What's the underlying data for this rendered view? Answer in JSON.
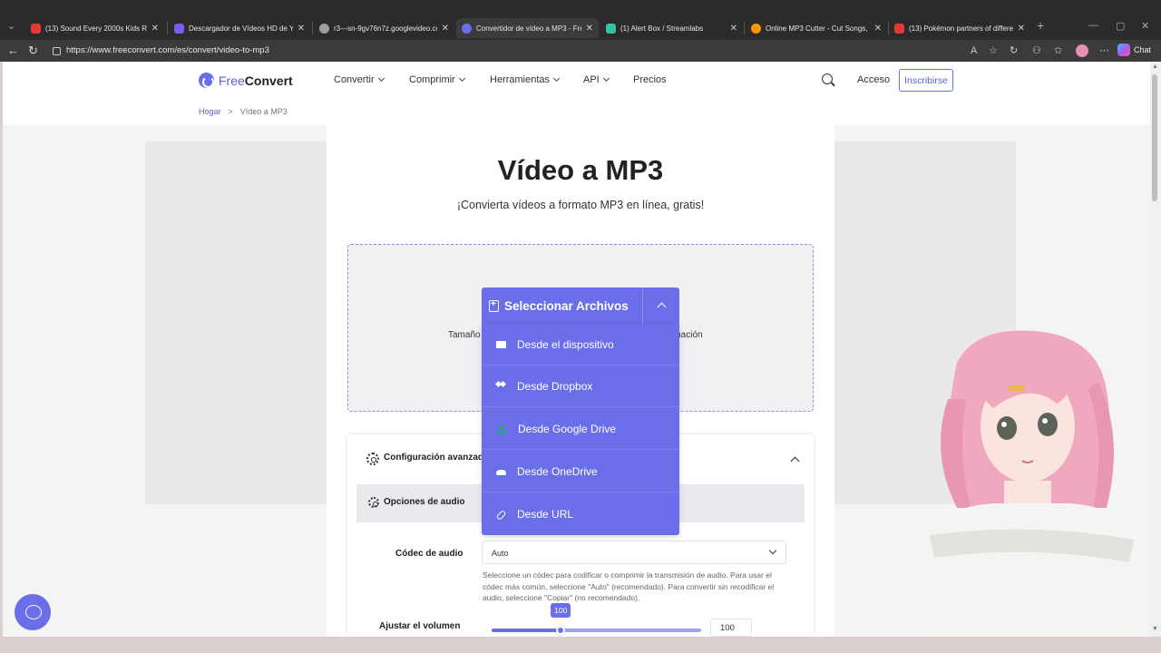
{
  "browser": {
    "tabs": [
      {
        "title": "(13) Sound Every 2000s Kids Reme",
        "active": false,
        "color": "#e53935"
      },
      {
        "title": "Descargador de Vídeos HD de You",
        "active": false,
        "color": "#7b5cf2"
      },
      {
        "title": "r3---sn-9gv76n7z.googlevideo.com",
        "active": false,
        "color": "#9e9e9e"
      },
      {
        "title": "Convertidor de vídeo a MP3 - Fre",
        "active": true,
        "color": "#6a6ee8"
      },
      {
        "title": "(1) Alert Box / Streamlabs",
        "active": false,
        "color": "#31c3a2"
      },
      {
        "title": "Online MP3 Cutter - Cut Songs, M",
        "active": false,
        "color": "#ff9800"
      },
      {
        "title": "(13) Pokémon partners of differen",
        "active": false,
        "color": "#e53935"
      }
    ],
    "url": "https://www.freeconvert.com/es/convert/video-to-mp3",
    "chat_label": "Chat"
  },
  "header": {
    "logo_free": "Free",
    "logo_convert": "Convert",
    "menu": [
      "Convertir",
      "Comprimir",
      "Herramientas",
      "API",
      "Precios"
    ],
    "login": "Acceso",
    "signup": "Inscribirse"
  },
  "breadcrumb": {
    "home": "Hogar",
    "separator": ">",
    "current": "Vídeo a MP3"
  },
  "main": {
    "title": "Vídeo a MP3",
    "subtitle": "¡Convierta vídeos a formato MP3 en línea, gratis!",
    "dropzone_left": "Tamaño",
    "dropzone_right": "rmación"
  },
  "select_files": {
    "label": "Seleccionar Archivos",
    "options": [
      {
        "label": "Desde el dispositivo",
        "icon": "folder-icon"
      },
      {
        "label": "Desde Dropbox",
        "icon": "dropbox-icon"
      },
      {
        "label": "Desde Google Drive",
        "icon": "google-drive-icon"
      },
      {
        "label": "Desde OneDrive",
        "icon": "onedrive-icon"
      },
      {
        "label": "Desde URL",
        "icon": "link-icon"
      }
    ]
  },
  "settings": {
    "title": "Configuración avanzada",
    "audio_section": "Opciones de audio",
    "codec_label": "Códec de audio",
    "codec_value": "Auto",
    "codec_help": "Seleccione un códec para codificar o comprimir la transmisión de audio. Para usar el códec más común, seleccione \"Auto\" (recomendado). Para convertir sin recodificar el audio, seleccione \"Copiar\" (no recomendado).",
    "volume_label": "Ajustar el volumen",
    "volume_value": "100",
    "volume_fraction": 0.33
  },
  "colors": {
    "accent": "#6a6ee8"
  }
}
